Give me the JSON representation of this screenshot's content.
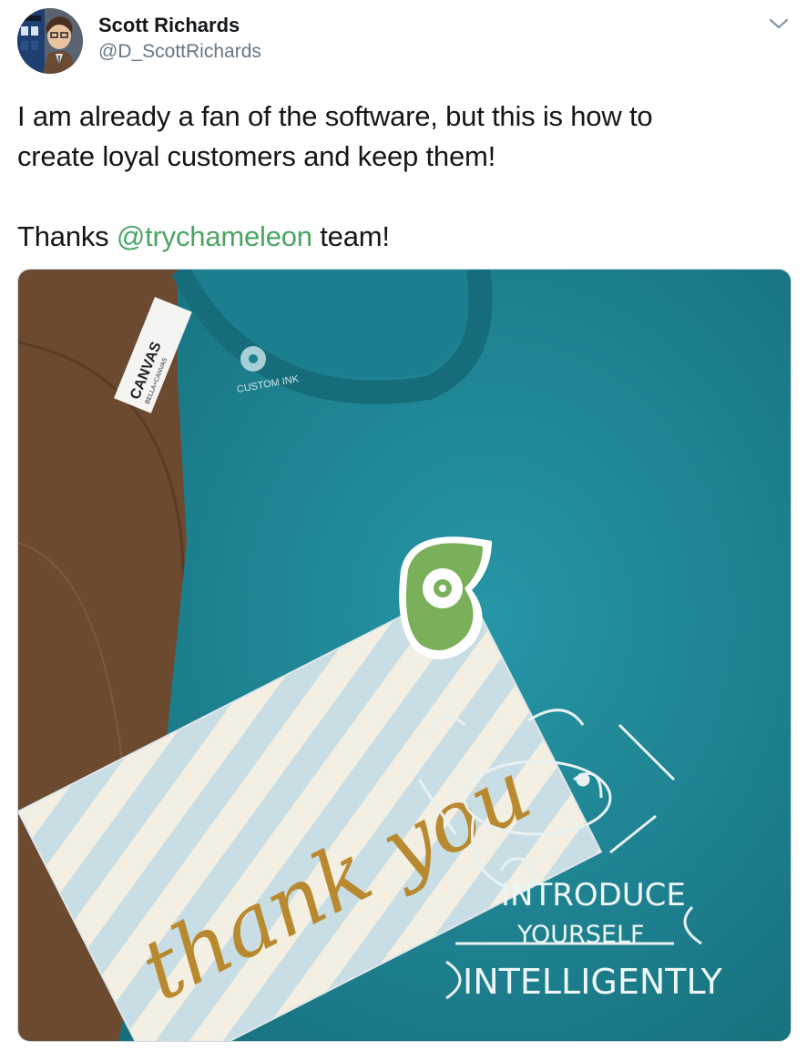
{
  "author": {
    "name": "Scott Richards",
    "handle": "@D_ScottRichards",
    "avatar_icon": "avatar-doctor-who-icon"
  },
  "menu_icon": "chevron-down-icon",
  "tweet": {
    "line1": "I am already a fan of the software, but this is how to",
    "line2": "create loyal customers and keep them!",
    "line3_prefix": "Thanks ",
    "mention": "@trychameleon",
    "line3_suffix": " team!"
  },
  "media": {
    "card_text": "thank you",
    "shirt_tag_text": "CANVAS",
    "shirt_tag_subtext": "BELLA+CANVAS",
    "inner_label": "CUSTOM INK",
    "print_line1": "INTRODUCE",
    "print_line2": "YOURSELF",
    "print_line3": "INTELLIGENTLY"
  },
  "colors": {
    "text": "#14171a",
    "muted": "#657786",
    "link": "#4aa564",
    "shirt": "#1f8798",
    "table": "#6b4a30",
    "card_stripe": "#c9dde4",
    "gold": "#b8892e",
    "logo_green": "#7ab05a"
  }
}
